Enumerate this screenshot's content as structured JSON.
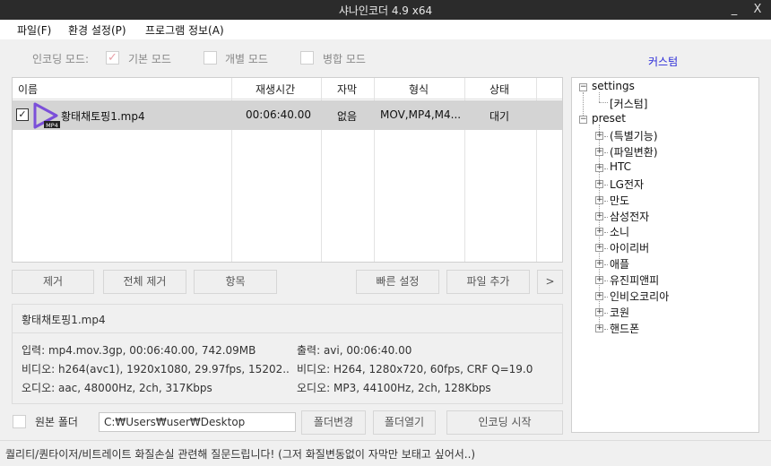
{
  "window": {
    "title": "샤나인코더 4.9 x64",
    "minimize": "_",
    "close": "X"
  },
  "menu": {
    "file": "파일(F)",
    "env": "환경 설정(P)",
    "program": "프로그램 정보(A)"
  },
  "modes": {
    "label": "인코딩 모드:",
    "basic": "기본 모드",
    "individual": "개별 모드",
    "merge": "병합 모드",
    "selected": "basic"
  },
  "custom_link": "커스텀",
  "columns": {
    "name": "이름",
    "duration": "재생시간",
    "subtitle": "자막",
    "format": "형식",
    "status": "상태"
  },
  "files": [
    {
      "checked": true,
      "icon": "mp4-play-icon",
      "icon_badge": "MP4",
      "name": "황태채토핑1.mp4",
      "duration": "00:06:40.00",
      "subtitle": "없음",
      "format": "MOV,MP4,M4...",
      "status": "대기"
    }
  ],
  "buttons": {
    "remove": "제거",
    "remove_all": "전체 제거",
    "items": "항목",
    "quick": "빠른 설정",
    "add": "파일 추가",
    "more": ">"
  },
  "info": {
    "filename": "황태채토핑1.mp4",
    "input": "입력: mp4.mov.3gp, 00:06:40.00, 742.09MB",
    "video_in": "비디오: h264(avc1), 1920x1080, 29.97fps, 15202...",
    "audio_in": "오디오: aac, 48000Hz, 2ch, 317Kbps",
    "output": "출력: avi, 00:06:40.00",
    "video_out": "비디오: H264, 1280x720, 60fps, CRF Q=19.0",
    "audio_out": "오디오: MP3, 44100Hz, 2ch, 128Kbps"
  },
  "tree": {
    "settings": {
      "label": "settings",
      "children": [
        "[커스텀]"
      ]
    },
    "preset": {
      "label": "preset",
      "children": [
        "(특별기능)",
        "(파일변환)",
        "HTC",
        "LG전자",
        "만도",
        "삼성전자",
        "소니",
        "아이리버",
        "애플",
        "유진피앤피",
        "인비오코리아",
        "코원",
        "핸드폰"
      ]
    }
  },
  "bottom": {
    "source_folder_label": "원본 폴더",
    "source_folder_checked": false,
    "path": "C:₩Users₩user₩Desktop",
    "change_folder": "폴더변경",
    "open_folder": "폴더열기",
    "start": "인코딩 시작"
  },
  "status_text": "퀄리티/퀀타이저/비트레이트 화질손실 관련해 질문드립니다! (그저 화질변동없이 자막만 보태고 싶어서..)",
  "colors": {
    "titlebar": "#2b2b2b",
    "selected_row": "#d4d4d4",
    "link": "#2a2ad8",
    "play_icon": "#7b4fd9"
  }
}
